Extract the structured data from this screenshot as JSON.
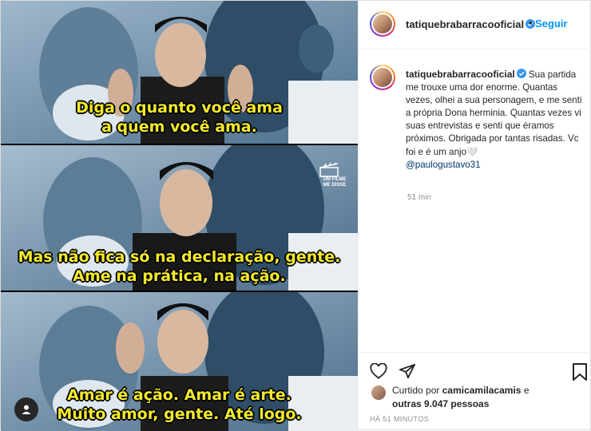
{
  "post": {
    "username": "tatiquebrabarracooficial",
    "separator": "•",
    "follow_label": "Seguir",
    "caption_username": "tatiquebrabarracooficial",
    "caption_text": "Sua partida me trouxe uma dor enorme. Quantas vezes, olhei a sua personagem, e me senti a própria Dona herminia. Quantas vezes vi suas entrevistas e senti que éramos próximos. Obrigada por tantas risadas. Vc foi e é um anjo🤍",
    "caption_mention": "@paulogustavo31",
    "caption_time": "51 min",
    "liked_by_prefix": "Curtido por",
    "liked_by_user": "camicamilacamis",
    "liked_by_suffix_a": "e",
    "liked_by_others": "outras 9.047 pessoas",
    "posted_ago": "HÁ 51 MINUTOS"
  },
  "media": {
    "panels": [
      {
        "lines": [
          "Diga o quanto você ama",
          "a quem você ama."
        ]
      },
      {
        "lines": [
          "Mas não fica só na declaração, gente.",
          "Ame na prática, na ação."
        ],
        "watermark": [
          "UM FILME",
          "ME DISSE"
        ]
      },
      {
        "lines": [
          "Amar é ação. Amar é arte.",
          "Muito amor, gente. Até logo."
        ]
      }
    ],
    "caption_color": "#f3ea2a"
  },
  "colors": {
    "link_blue": "#0095f6",
    "text": "#262626",
    "muted": "#8e8e8e",
    "mention": "#00376b"
  },
  "icons": {
    "verified": "verified-badge-icon",
    "like": "heart-icon",
    "share": "share-icon",
    "save": "bookmark-icon",
    "tagged": "user-icon"
  }
}
